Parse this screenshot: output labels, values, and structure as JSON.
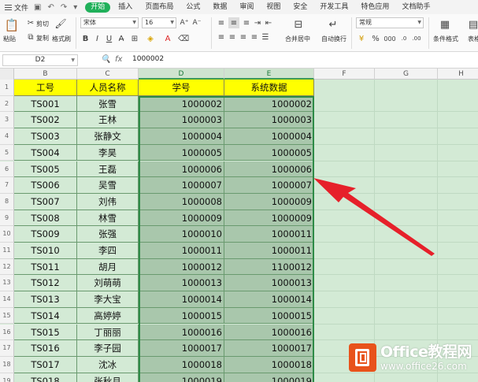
{
  "menu": {
    "file_label": "文件",
    "tabs": [
      "开始",
      "插入",
      "页面布局",
      "公式",
      "数据",
      "审阅",
      "视图",
      "安全",
      "开发工具",
      "特色应用",
      "文档助手"
    ],
    "active_tab": "开始"
  },
  "ribbon": {
    "paste": "粘贴",
    "cut": "剪切",
    "copy": "复制",
    "format_painter": "格式刷",
    "font_name": "宋体",
    "font_size": "16",
    "merge_center": "合并居中",
    "wrap": "自动换行",
    "number_format": "常规",
    "cond_format": "条件格式",
    "table_style": "表格"
  },
  "formula_bar": {
    "name_box": "D2",
    "fx": "fx",
    "value": "1000002"
  },
  "columns": [
    "B",
    "C",
    "D",
    "E",
    "F",
    "G",
    "H"
  ],
  "header_row": [
    "工号",
    "人员名称",
    "学号",
    "系统数据"
  ],
  "rows": [
    {
      "n": "2",
      "id": "TS001",
      "name": "张雪",
      "sid": "1000002",
      "sys": "1000002"
    },
    {
      "n": "3",
      "id": "TS002",
      "name": "王林",
      "sid": "1000003",
      "sys": "1000003"
    },
    {
      "n": "4",
      "id": "TS003",
      "name": "张静文",
      "sid": "1000004",
      "sys": "1000004"
    },
    {
      "n": "5",
      "id": "TS004",
      "name": "李昊",
      "sid": "1000005",
      "sys": "1000005"
    },
    {
      "n": "6",
      "id": "TS005",
      "name": "王磊",
      "sid": "1000006",
      "sys": "1000006"
    },
    {
      "n": "7",
      "id": "TS006",
      "name": "吴雪",
      "sid": "1000007",
      "sys": "1000007"
    },
    {
      "n": "8",
      "id": "TS007",
      "name": "刘伟",
      "sid": "1000008",
      "sys": "1000009"
    },
    {
      "n": "9",
      "id": "TS008",
      "name": "林雪",
      "sid": "1000009",
      "sys": "1000009"
    },
    {
      "n": "10",
      "id": "TS009",
      "name": "张强",
      "sid": "1000010",
      "sys": "1000011"
    },
    {
      "n": "11",
      "id": "TS010",
      "name": "李四",
      "sid": "1000011",
      "sys": "1000011"
    },
    {
      "n": "12",
      "id": "TS011",
      "name": "胡月",
      "sid": "1000012",
      "sys": "1100012"
    },
    {
      "n": "13",
      "id": "TS012",
      "name": "刘萌萌",
      "sid": "1000013",
      "sys": "1000013"
    },
    {
      "n": "14",
      "id": "TS013",
      "name": "李大宝",
      "sid": "1000014",
      "sys": "1000014"
    },
    {
      "n": "15",
      "id": "TS014",
      "name": "高婷婷",
      "sid": "1000015",
      "sys": "1000015"
    },
    {
      "n": "16",
      "id": "TS015",
      "name": "丁丽丽",
      "sid": "1000016",
      "sys": "1000016"
    },
    {
      "n": "17",
      "id": "TS016",
      "name": "李子园",
      "sid": "1000017",
      "sys": "1000017"
    },
    {
      "n": "18",
      "id": "TS017",
      "name": "沈冰",
      "sid": "1000018",
      "sys": "1000018"
    },
    {
      "n": "19",
      "id": "TS018",
      "name": "张秋月",
      "sid": "1000019",
      "sys": "1000019"
    }
  ],
  "logo": {
    "title": "Office教程网",
    "url": "www.office26.com"
  },
  "colors": {
    "header_fill": "#ffff00",
    "sheet_green": "#d3ead5",
    "selection_fill": "#a9c7ac",
    "arrow_red": "#e6202a"
  }
}
